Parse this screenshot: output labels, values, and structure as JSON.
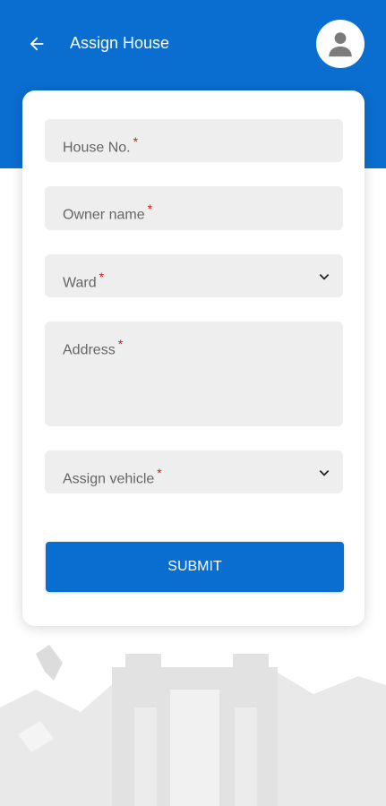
{
  "header": {
    "title": "Assign House",
    "back_icon": "arrow-left-icon",
    "avatar_icon": "user-icon",
    "background_color": "#0a6ed1"
  },
  "form": {
    "house_no": {
      "label": "House No.",
      "required_mark": "*"
    },
    "owner_name": {
      "label": "Owner name",
      "required_mark": "*"
    },
    "ward": {
      "label": "Ward",
      "required_mark": "*",
      "icon": "chevron-down-icon"
    },
    "address": {
      "label": "Address",
      "required_mark": "*"
    },
    "assign_vehicle": {
      "label": "Assign vehicle",
      "required_mark": "*",
      "icon": "chevron-down-icon"
    },
    "submit_label": "SUBMIT"
  },
  "colors": {
    "accent": "#0a6ed1",
    "field_bg": "#eeeeee",
    "required": "#e01515"
  }
}
